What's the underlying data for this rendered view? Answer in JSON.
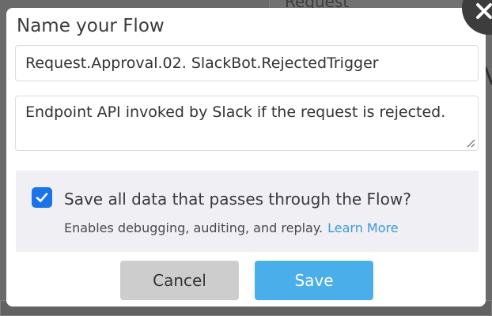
{
  "background": {
    "top_label": "Request",
    "side_text": "Va"
  },
  "modal": {
    "title": "Name your Flow",
    "flow_name_value": "Request.Approval.02. SlackBot.RejectedTrigger",
    "description_value": "Endpoint API invoked by Slack if the request is rejected.",
    "save_data": {
      "checked": true,
      "label": "Save all data that passes through the Flow?",
      "help_text": "Enables debugging, auditing, and replay.",
      "learn_more": "Learn More"
    },
    "buttons": {
      "cancel": "Cancel",
      "save": "Save"
    }
  },
  "colors": {
    "accent": "#4aaeea",
    "checkbox": "#1a73e8",
    "link": "#3a9ad9",
    "overlay": "#6a6a6a"
  },
  "icons": {
    "close": "close-icon",
    "check": "checkmark-icon",
    "resize": "resize-handle-icon"
  }
}
